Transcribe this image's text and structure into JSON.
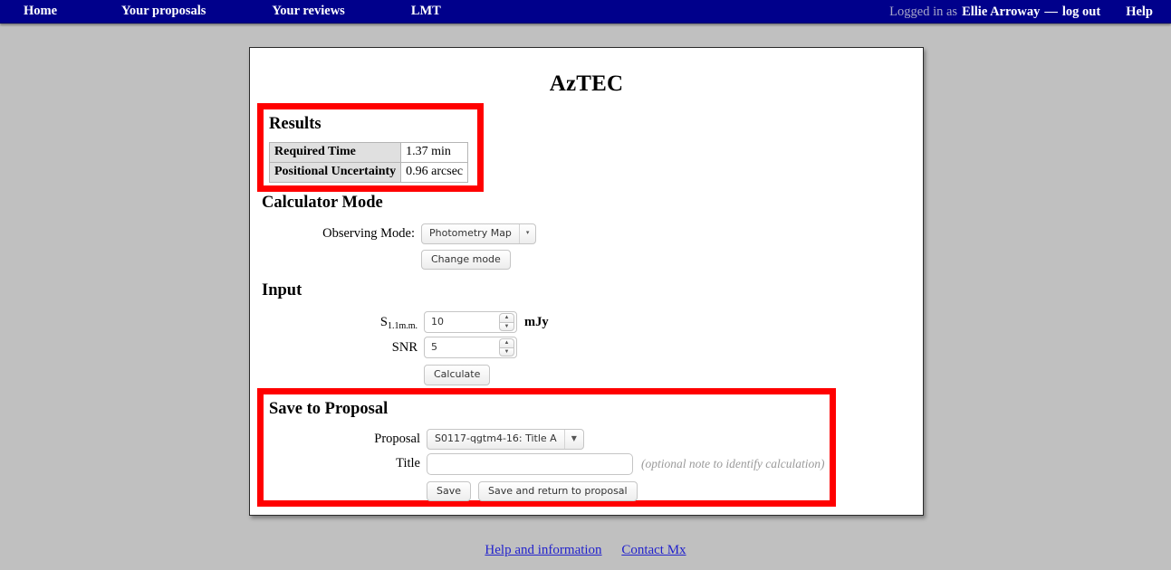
{
  "navbar": {
    "links": [
      {
        "label": "Home"
      },
      {
        "label": "Your proposals"
      },
      {
        "label": "Your reviews"
      },
      {
        "label": "LMT"
      }
    ],
    "logged_in_prefix": "Logged in as",
    "user_name": "Ellie Arroway",
    "dash": "—",
    "logout_label": "log out",
    "help_label": "Help"
  },
  "page": {
    "title": "AzTEC"
  },
  "results": {
    "heading": "Results",
    "rows": [
      {
        "label": "Required Time",
        "value": "1.37 min"
      },
      {
        "label": "Positional Uncertainty",
        "value": "0.96 arcsec"
      }
    ]
  },
  "calculator_mode": {
    "heading": "Calculator Mode",
    "observing_mode_label": "Observing Mode:",
    "observing_mode_value": "Photometry Map",
    "change_mode_label": "Change mode"
  },
  "input": {
    "heading": "Input",
    "flux_label_base": "S",
    "flux_label_sub": "1.1m.m.",
    "flux_value": "10",
    "flux_unit": "mJy",
    "snr_label": "SNR",
    "snr_value": "5",
    "calculate_label": "Calculate"
  },
  "save_to_proposal": {
    "heading": "Save to Proposal",
    "proposal_label": "Proposal",
    "proposal_value": "S0117-qgtm4-16: Title A",
    "title_label": "Title",
    "title_value": "",
    "title_placeholder": "",
    "title_hint": "(optional note to identify calculation)",
    "save_label": "Save",
    "save_return_label": "Save and return to proposal"
  },
  "footer": {
    "links": [
      {
        "label": "Help and information"
      },
      {
        "label": "Contact Mx"
      }
    ]
  },
  "colors": {
    "navbar_bg": "#00008b",
    "page_bg": "#c0c0c0",
    "highlight": "#ff0000",
    "link": "#2222cc",
    "table_header_bg": "#e0e0e0"
  }
}
